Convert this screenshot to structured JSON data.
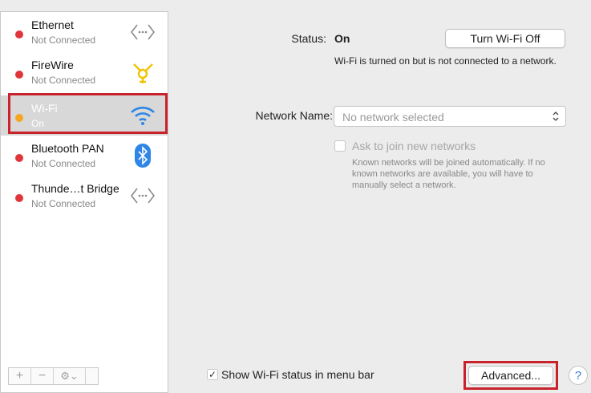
{
  "services": [
    {
      "name": "Ethernet",
      "status": "Not Connected",
      "dot_color": "#e0353a",
      "icon": "ethernet-arrows-icon"
    },
    {
      "name": "FireWire",
      "status": "Not Connected",
      "dot_color": "#e0353a",
      "icon": "firewire-icon"
    },
    {
      "name": "Wi-Fi",
      "status": "On",
      "dot_color": "#f5a623",
      "icon": "wifi-icon",
      "selected": true
    },
    {
      "name": "Bluetooth PAN",
      "status": "Not Connected",
      "dot_color": "#e0353a",
      "icon": "bluetooth-icon"
    },
    {
      "name": "Thunde…t Bridge",
      "status": "Not Connected",
      "dot_color": "#e0353a",
      "icon": "thunderbolt-arrows-icon"
    }
  ],
  "sidebar_tools": {
    "add": "+",
    "remove": "−",
    "gear": "⚙︎⌄"
  },
  "main": {
    "status_label": "Status:",
    "status_value": "On",
    "turn_off_button": "Turn Wi-Fi Off",
    "status_description": "Wi-Fi is turned on but is not connected to a network.",
    "network_name_label": "Network Name:",
    "network_name_placeholder": "No network selected",
    "ask_to_join_label": "Ask to join new networks",
    "ask_to_join_description": "Known networks will be joined automatically. If no known networks are available, you will have to manually select a network.",
    "show_status_label": "Show Wi-Fi status in menu bar",
    "show_status_checked": true,
    "advanced_button": "Advanced...",
    "help_button": "?"
  },
  "colors": {
    "highlight_red": "#c8232a",
    "selected_bg": "#d8d8d8"
  }
}
